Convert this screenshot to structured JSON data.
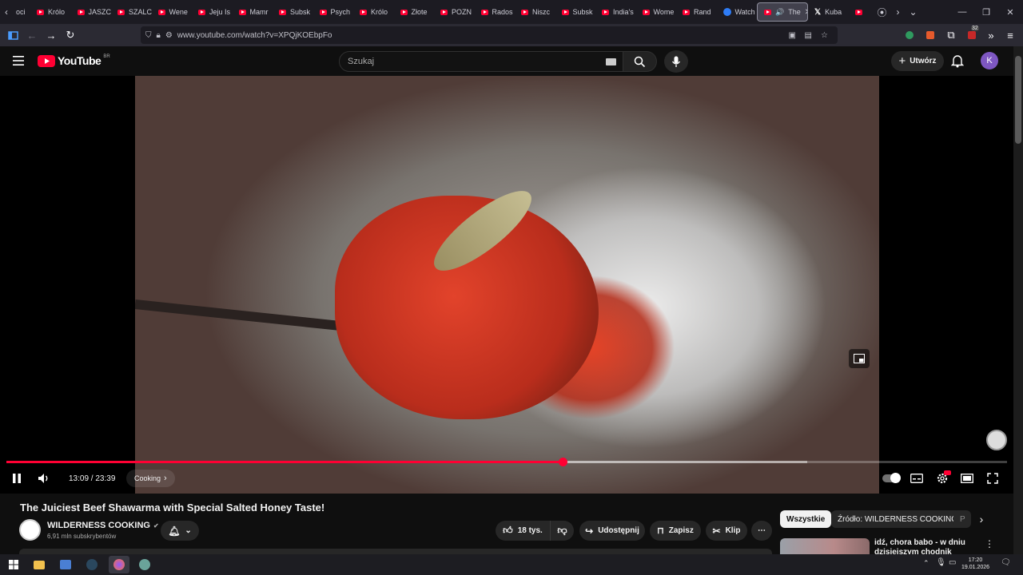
{
  "browser": {
    "tabs": [
      {
        "label": "oci",
        "icon": "chevron-left-icon"
      },
      {
        "label": "Królo",
        "icon": "youtube-favicon"
      },
      {
        "label": "JASZC",
        "icon": "youtube-favicon"
      },
      {
        "label": "SZALC",
        "icon": "youtube-favicon"
      },
      {
        "label": "Wene",
        "icon": "youtube-favicon"
      },
      {
        "label": "Jeju Is",
        "icon": "youtube-favicon"
      },
      {
        "label": "Mamr",
        "icon": "youtube-favicon"
      },
      {
        "label": "Subsk",
        "icon": "youtube-favicon"
      },
      {
        "label": "Psych",
        "icon": "youtube-favicon"
      },
      {
        "label": "Królo",
        "icon": "youtube-favicon"
      },
      {
        "label": "Złote",
        "icon": "youtube-favicon"
      },
      {
        "label": "POZN",
        "icon": "youtube-favicon"
      },
      {
        "label": "Rados",
        "icon": "youtube-favicon"
      },
      {
        "label": "Niszc",
        "icon": "youtube-favicon"
      },
      {
        "label": "Subsk",
        "icon": "youtube-favicon"
      },
      {
        "label": "India's",
        "icon": "youtube-favicon"
      },
      {
        "label": "Wome",
        "icon": "youtube-favicon"
      },
      {
        "label": "Rand",
        "icon": "youtube-favicon"
      },
      {
        "label": "Watch",
        "icon": "globe-favicon"
      }
    ],
    "active_tab": {
      "label": "The",
      "icon": "youtube-favicon"
    },
    "extra_tab": {
      "label": "Kuba",
      "icon": "x-favicon"
    },
    "url": "www.youtube.com/watch?v=XPQjKOEbpFo",
    "notification_count": "32"
  },
  "youtube": {
    "logo_text": "YouTube",
    "region": "BR",
    "search_placeholder": "Szukaj",
    "create_label": "Utwórz",
    "avatar_letter": "K"
  },
  "player": {
    "time_current": "13:09",
    "time_total": "23:39",
    "time_display": "13:09 / 23:39",
    "chapter": "Cooking",
    "progress": 0.556,
    "loaded": 0.8
  },
  "video": {
    "title": "The Juiciest Beef Shawarma with Special Salted Honey Taste!",
    "channel": "WILDERNESS COOKING",
    "subscribers": "6,91 mln subskrybentów",
    "likes": "18 tys.",
    "share": "Udostępnij",
    "save": "Zapisz",
    "clip": "Klip"
  },
  "sidebar": {
    "chips": [
      "Wszystkie",
      "Źródło: WILDERNESS COOKING",
      "P"
    ],
    "first_item_title": "idź, chora babo - w dniu",
    "first_item_title2": "dzisiejszym chodnik nieszym..."
  },
  "taskbar": {
    "time": "17:20",
    "date": "19.01.2026"
  }
}
